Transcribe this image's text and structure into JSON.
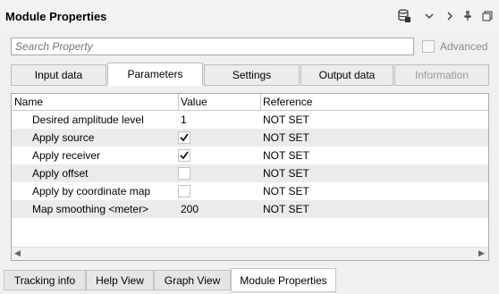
{
  "window": {
    "title": "Module Properties",
    "icons": [
      "database-lock-icon",
      "chevron-down-icon",
      "chevron-right-icon",
      "pin-icon",
      "restore-icon"
    ]
  },
  "search": {
    "placeholder": "Search Property",
    "advanced_label": "Advanced"
  },
  "tabs": [
    {
      "label": "Input data",
      "state": "normal"
    },
    {
      "label": "Parameters",
      "state": "active"
    },
    {
      "label": "Settings",
      "state": "normal"
    },
    {
      "label": "Output data",
      "state": "normal"
    },
    {
      "label": "Information",
      "state": "disabled"
    }
  ],
  "table": {
    "columns": [
      "Name",
      "Value",
      "Reference"
    ],
    "rows": [
      {
        "name": "Desired amplitude level",
        "value": "1",
        "type": "text",
        "reference": "NOT SET"
      },
      {
        "name": "Apply source",
        "checked": true,
        "type": "checkbox",
        "reference": "NOT SET"
      },
      {
        "name": "Apply receiver",
        "checked": true,
        "type": "checkbox",
        "reference": "NOT SET"
      },
      {
        "name": "Apply offset",
        "checked": false,
        "type": "checkbox",
        "reference": "NOT SET"
      },
      {
        "name": "Apply by coordinate map",
        "checked": false,
        "type": "checkbox",
        "reference": "NOT SET"
      },
      {
        "name": "Map smoothing <meter>",
        "value": "200",
        "type": "text",
        "reference": "NOT SET"
      }
    ]
  },
  "bottom_tabs": [
    {
      "label": "Tracking info",
      "active": false
    },
    {
      "label": "Help View",
      "active": false
    },
    {
      "label": "Graph View",
      "active": false
    },
    {
      "label": "Module Properties",
      "active": true
    }
  ],
  "colors": {
    "alt_row": "#ebebeb",
    "border": "#a8a8a8",
    "disabled_text": "#9a9a9a"
  }
}
